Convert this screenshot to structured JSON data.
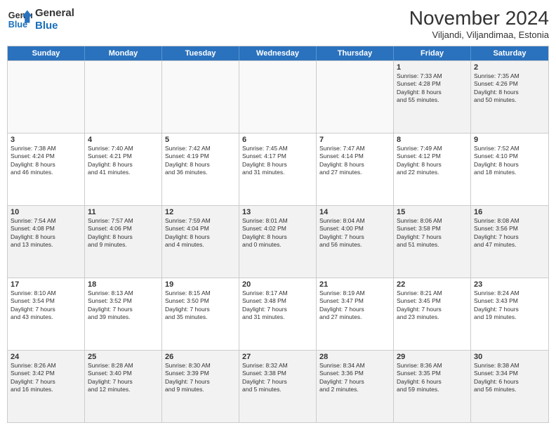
{
  "logo": {
    "line1": "General",
    "line2": "Blue"
  },
  "title": "November 2024",
  "subtitle": "Viljandi, Viljandimaa, Estonia",
  "days_of_week": [
    "Sunday",
    "Monday",
    "Tuesday",
    "Wednesday",
    "Thursday",
    "Friday",
    "Saturday"
  ],
  "weeks": [
    [
      {
        "day": "",
        "info": "",
        "empty": true
      },
      {
        "day": "",
        "info": "",
        "empty": true
      },
      {
        "day": "",
        "info": "",
        "empty": true
      },
      {
        "day": "",
        "info": "",
        "empty": true
      },
      {
        "day": "",
        "info": "",
        "empty": true
      },
      {
        "day": "1",
        "info": "Sunrise: 7:33 AM\nSunset: 4:28 PM\nDaylight: 8 hours\nand 55 minutes."
      },
      {
        "day": "2",
        "info": "Sunrise: 7:35 AM\nSunset: 4:26 PM\nDaylight: 8 hours\nand 50 minutes."
      }
    ],
    [
      {
        "day": "3",
        "info": "Sunrise: 7:38 AM\nSunset: 4:24 PM\nDaylight: 8 hours\nand 46 minutes."
      },
      {
        "day": "4",
        "info": "Sunrise: 7:40 AM\nSunset: 4:21 PM\nDaylight: 8 hours\nand 41 minutes."
      },
      {
        "day": "5",
        "info": "Sunrise: 7:42 AM\nSunset: 4:19 PM\nDaylight: 8 hours\nand 36 minutes."
      },
      {
        "day": "6",
        "info": "Sunrise: 7:45 AM\nSunset: 4:17 PM\nDaylight: 8 hours\nand 31 minutes."
      },
      {
        "day": "7",
        "info": "Sunrise: 7:47 AM\nSunset: 4:14 PM\nDaylight: 8 hours\nand 27 minutes."
      },
      {
        "day": "8",
        "info": "Sunrise: 7:49 AM\nSunset: 4:12 PM\nDaylight: 8 hours\nand 22 minutes."
      },
      {
        "day": "9",
        "info": "Sunrise: 7:52 AM\nSunset: 4:10 PM\nDaylight: 8 hours\nand 18 minutes."
      }
    ],
    [
      {
        "day": "10",
        "info": "Sunrise: 7:54 AM\nSunset: 4:08 PM\nDaylight: 8 hours\nand 13 minutes."
      },
      {
        "day": "11",
        "info": "Sunrise: 7:57 AM\nSunset: 4:06 PM\nDaylight: 8 hours\nand 9 minutes."
      },
      {
        "day": "12",
        "info": "Sunrise: 7:59 AM\nSunset: 4:04 PM\nDaylight: 8 hours\nand 4 minutes."
      },
      {
        "day": "13",
        "info": "Sunrise: 8:01 AM\nSunset: 4:02 PM\nDaylight: 8 hours\nand 0 minutes."
      },
      {
        "day": "14",
        "info": "Sunrise: 8:04 AM\nSunset: 4:00 PM\nDaylight: 7 hours\nand 56 minutes."
      },
      {
        "day": "15",
        "info": "Sunrise: 8:06 AM\nSunset: 3:58 PM\nDaylight: 7 hours\nand 51 minutes."
      },
      {
        "day": "16",
        "info": "Sunrise: 8:08 AM\nSunset: 3:56 PM\nDaylight: 7 hours\nand 47 minutes."
      }
    ],
    [
      {
        "day": "17",
        "info": "Sunrise: 8:10 AM\nSunset: 3:54 PM\nDaylight: 7 hours\nand 43 minutes."
      },
      {
        "day": "18",
        "info": "Sunrise: 8:13 AM\nSunset: 3:52 PM\nDaylight: 7 hours\nand 39 minutes."
      },
      {
        "day": "19",
        "info": "Sunrise: 8:15 AM\nSunset: 3:50 PM\nDaylight: 7 hours\nand 35 minutes."
      },
      {
        "day": "20",
        "info": "Sunrise: 8:17 AM\nSunset: 3:48 PM\nDaylight: 7 hours\nand 31 minutes."
      },
      {
        "day": "21",
        "info": "Sunrise: 8:19 AM\nSunset: 3:47 PM\nDaylight: 7 hours\nand 27 minutes."
      },
      {
        "day": "22",
        "info": "Sunrise: 8:21 AM\nSunset: 3:45 PM\nDaylight: 7 hours\nand 23 minutes."
      },
      {
        "day": "23",
        "info": "Sunrise: 8:24 AM\nSunset: 3:43 PM\nDaylight: 7 hours\nand 19 minutes."
      }
    ],
    [
      {
        "day": "24",
        "info": "Sunrise: 8:26 AM\nSunset: 3:42 PM\nDaylight: 7 hours\nand 16 minutes."
      },
      {
        "day": "25",
        "info": "Sunrise: 8:28 AM\nSunset: 3:40 PM\nDaylight: 7 hours\nand 12 minutes."
      },
      {
        "day": "26",
        "info": "Sunrise: 8:30 AM\nSunset: 3:39 PM\nDaylight: 7 hours\nand 9 minutes."
      },
      {
        "day": "27",
        "info": "Sunrise: 8:32 AM\nSunset: 3:38 PM\nDaylight: 7 hours\nand 5 minutes."
      },
      {
        "day": "28",
        "info": "Sunrise: 8:34 AM\nSunset: 3:36 PM\nDaylight: 7 hours\nand 2 minutes."
      },
      {
        "day": "29",
        "info": "Sunrise: 8:36 AM\nSunset: 3:35 PM\nDaylight: 6 hours\nand 59 minutes."
      },
      {
        "day": "30",
        "info": "Sunrise: 8:38 AM\nSunset: 3:34 PM\nDaylight: 6 hours\nand 56 minutes."
      }
    ]
  ]
}
